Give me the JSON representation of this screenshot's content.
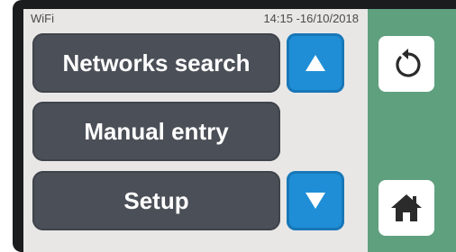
{
  "status": {
    "title": "WiFi",
    "datetime": "14:15 -16/10/2018"
  },
  "menu": {
    "items": [
      {
        "label": "Networks search"
      },
      {
        "label": "Manual entry"
      },
      {
        "label": "Setup"
      }
    ]
  },
  "nav": {
    "scroll_up_icon": "triangle-up",
    "scroll_down_icon": "triangle-down",
    "back_icon": "undo-arrow",
    "home_icon": "house"
  },
  "colors": {
    "button": "#4b4f57",
    "arrow": "#1f8ed6",
    "side_panel": "#5fa07e",
    "screen": "#e8e7e6"
  }
}
